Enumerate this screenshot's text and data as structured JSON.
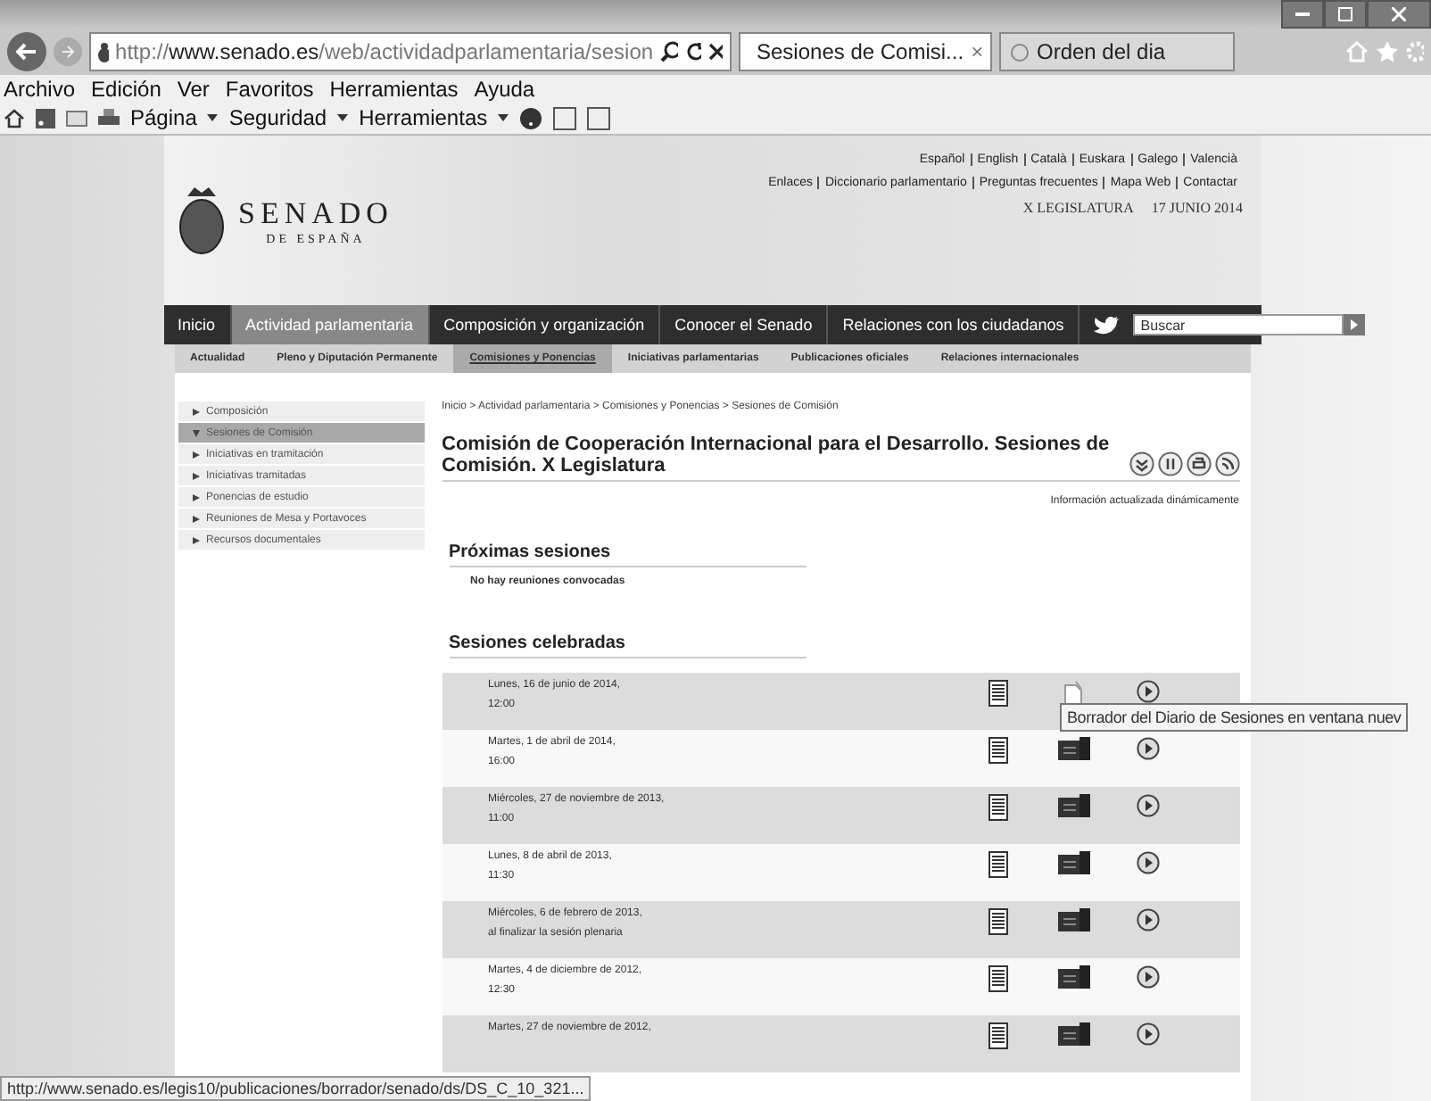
{
  "browser": {
    "address": "http://**www.senado.es**/web/actividadparlamentaria/sesion",
    "tabs": [
      {
        "label": "Sesiones de Comisi...",
        "selected": true,
        "close": "×"
      },
      {
        "label": "Orden del dia",
        "selected": false
      }
    ],
    "menu": [
      "Archivo",
      "Edición",
      "Ver",
      "Favoritos",
      "Herramientas",
      "Ayuda"
    ],
    "commands": [
      "Página",
      "Seguridad",
      "Herramientas"
    ],
    "status_url": "http://www.senado.es/legis10/publicaciones/borrador/senado/ds/DS_C_10_321..."
  },
  "header": {
    "logo_title": "SENADO",
    "logo_subtitle": "DE ESPAÑA",
    "languages": [
      "Español",
      "English",
      "Català",
      "Euskara",
      "Galego",
      "Valencià"
    ],
    "links": [
      "Enlaces",
      "Diccionario parlamentario",
      "Preguntas frecuentes",
      "Mapa Web",
      "Contactar"
    ],
    "legislatura": "X LEGISLATURA",
    "date": "17 JUNIO 2014"
  },
  "nav": [
    {
      "label": "Inicio",
      "selected": false
    },
    {
      "label": "Actividad parlamentaria",
      "selected": true
    },
    {
      "label": "Composición y organización",
      "selected": false
    },
    {
      "label": "Conocer el Senado",
      "selected": false
    },
    {
      "label": "Relaciones con los ciudadanos",
      "selected": false
    }
  ],
  "search": {
    "placeholder": "Buscar"
  },
  "subnav": [
    {
      "label": "Actualidad",
      "selected": false
    },
    {
      "label": "Pleno y Diputación Permanente",
      "selected": false
    },
    {
      "label": "Comisiones y Ponencias",
      "selected": true
    },
    {
      "label": "Iniciativas parlamentarias",
      "selected": false
    },
    {
      "label": "Publicaciones oficiales",
      "selected": false
    },
    {
      "label": "Relaciones internacionales",
      "selected": false
    }
  ],
  "sidebar": [
    {
      "label": "Composición",
      "selected": false
    },
    {
      "label": "Sesiones de Comisión",
      "selected": true
    },
    {
      "label": "Iniciativas en tramitación",
      "selected": false
    },
    {
      "label": "Iniciativas tramitadas",
      "selected": false
    },
    {
      "label": "Ponencias de estudio",
      "selected": false
    },
    {
      "label": "Reuniones de Mesa y Portavoces",
      "selected": false
    },
    {
      "label": "Recursos documentales",
      "selected": false
    }
  ],
  "breadcrumb": "Inicio > Actividad parlamentaria > Comisiones y Ponencias > Sesiones de Comisión",
  "title": "Comisión de Cooperación Internacional para el Desarrollo. Sesiones de Comisión. X Legislatura",
  "updated_note": "Información actualizada dinámicamente",
  "upcoming": {
    "heading": "Próximas sesiones",
    "empty": "No hay reuniones convocadas"
  },
  "past": {
    "heading": "Sesiones celebradas",
    "rows": [
      {
        "date": "Lunes, 16 de junio de 2014,",
        "time": "12:00",
        "kind": "draft"
      },
      {
        "date": "Martes, 1 de abril de 2014,",
        "time": "16:00",
        "kind": "diary"
      },
      {
        "date": "Miércoles, 27 de noviembre de 2013,",
        "time": "11:00",
        "kind": "diary"
      },
      {
        "date": "Lunes, 8 de abril de 2013,",
        "time": "11:30",
        "kind": "diary"
      },
      {
        "date": "Miércoles, 6 de febrero de 2013,",
        "time": "al finalizar la sesión plenaria",
        "kind": "diary"
      },
      {
        "date": "Martes, 4 de diciembre de 2012,",
        "time": "12:30",
        "kind": "diary"
      },
      {
        "date": "Martes, 27 de noviembre de 2012,",
        "kind": "diary"
      }
    ]
  },
  "tooltip": "Borrador del Diario de Sesiones en ventana nuev"
}
